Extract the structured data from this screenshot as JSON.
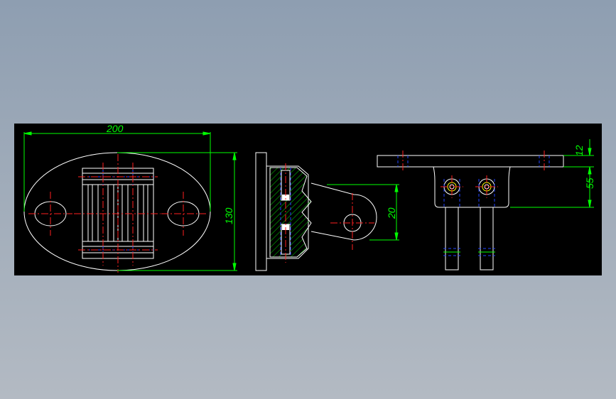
{
  "drawing": {
    "dimensions": {
      "front_width": "200",
      "front_height": "130",
      "side_height": "20",
      "top_thickness": "12",
      "top_height": "55"
    },
    "colors": {
      "background": "#000000",
      "outline": "#ffffff",
      "dimension": "#00ff00",
      "centerline": "#ff0000",
      "hidden": "#0000ff",
      "hatch": "#00cc00",
      "bolt": "#ffff00"
    }
  }
}
